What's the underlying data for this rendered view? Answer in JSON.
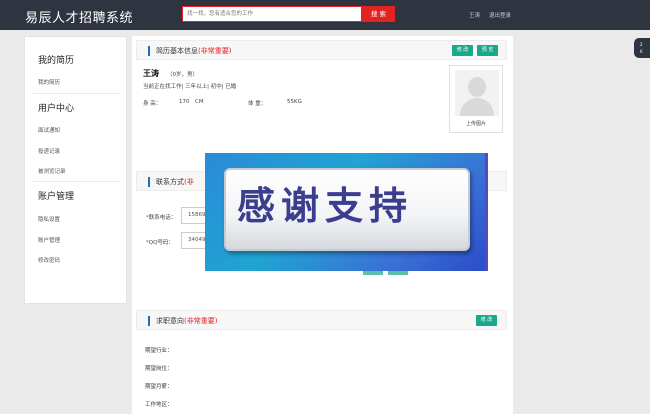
{
  "header": {
    "logo": "易辰人才招聘系统",
    "search_placeholder": "找一找，您有适合您的工作",
    "search_button": "搜 索",
    "user_name": "王涛",
    "logout": "退出登录"
  },
  "float_widget": {
    "line1": "2",
    "line2": "6"
  },
  "sidebar": {
    "sections": [
      {
        "heading": "我的简历",
        "items": [
          "我的简历"
        ]
      },
      {
        "heading": "用户中心",
        "items": [
          "面试通知",
          "投递记录",
          "被浏览记录"
        ]
      },
      {
        "heading": "账户管理",
        "items": [
          "隐私设置",
          "账户管理",
          "修改密码"
        ]
      }
    ]
  },
  "resume": {
    "title": "简历基本信息",
    "title_note": "(非常重要)",
    "edit_button": "修 改",
    "preview_button": "预 览",
    "name": "王涛",
    "meta": "（0岁，男）",
    "status": "当前正在找工作| 三年以上| 初中| 已婚",
    "height_label": "身 高：",
    "height_value": "170",
    "height_unit": "CM",
    "weight_label": "体 重：",
    "weight_value": "55KG",
    "photo_caption": "上传图片"
  },
  "contact": {
    "title": "联系方式",
    "title_note": "(非",
    "phone_label": "联系电话：",
    "phone_value": "15869",
    "qq_label": "QQ号码：",
    "qq_value": "34049"
  },
  "banner": {
    "text": "感谢支持"
  },
  "intention": {
    "title": "求职意向",
    "title_note": "(非常重要)",
    "edit_button": "修 改",
    "fields": [
      "期望行业：",
      "期望岗位：",
      "期望月薪：",
      "工作地区："
    ]
  },
  "colors": {
    "topbar": "#2e3540",
    "accent_red": "#e32222",
    "button_green": "#19a98a",
    "title_bar": "#1f6fb5"
  }
}
